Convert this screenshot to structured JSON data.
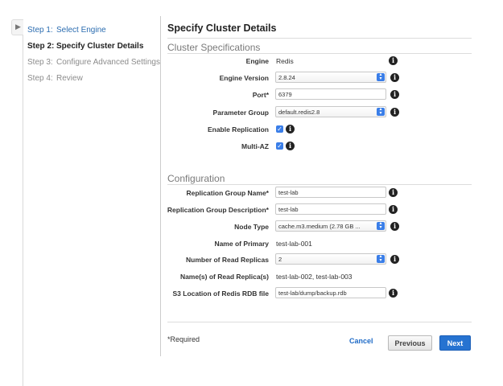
{
  "steps": [
    {
      "num": "Step 1:",
      "label": "Select Engine"
    },
    {
      "num": "Step 2:",
      "label": "Specify Cluster Details"
    },
    {
      "num": "Step 3:",
      "label": "Configure Advanced Settings"
    },
    {
      "num": "Step 4:",
      "label": "Review"
    }
  ],
  "page_title": "Specify Cluster Details",
  "cluster": {
    "section_title": "Cluster Specifications",
    "engine": {
      "label": "Engine",
      "value": "Redis"
    },
    "engine_version": {
      "label": "Engine Version",
      "value": "2.8.24"
    },
    "port": {
      "label": "Port*",
      "value": "6379"
    },
    "parameter_group": {
      "label": "Parameter Group",
      "value": "default.redis2.8"
    },
    "enable_replication": {
      "label": "Enable Replication",
      "checked": true
    },
    "multi_az": {
      "label": "Multi-AZ",
      "checked": true
    }
  },
  "config": {
    "section_title": "Configuration",
    "replication_group_name": {
      "label": "Replication Group Name*",
      "value": "test-lab"
    },
    "replication_group_description": {
      "label": "Replication Group Description*",
      "value": "test-lab"
    },
    "node_type": {
      "label": "Node Type",
      "value": "cache.m3.medium (2.78 GB ..."
    },
    "name_of_primary": {
      "label": "Name of Primary",
      "value": "test-lab-001"
    },
    "num_read_replicas": {
      "label": "Number of Read Replicas",
      "value": "2"
    },
    "read_replica_names": {
      "label": "Name(s) of Read Replica(s)",
      "value": "test-lab-002, test-lab-003"
    },
    "s3_location": {
      "label": "S3 Location of Redis RDB file",
      "value": "test-lab/dump/backup.rdb"
    }
  },
  "footer": {
    "required_note": "*Required",
    "cancel": "Cancel",
    "previous": "Previous",
    "next": "Next"
  },
  "icons": {
    "info": "info-icon",
    "collapse": "chevron-right-icon",
    "stepper": "select-stepper-icon",
    "check": "checkmark-icon"
  },
  "colors": {
    "link": "#2b6cb0",
    "primary_button": "#2673d1",
    "checkbox": "#3a7ee8"
  }
}
